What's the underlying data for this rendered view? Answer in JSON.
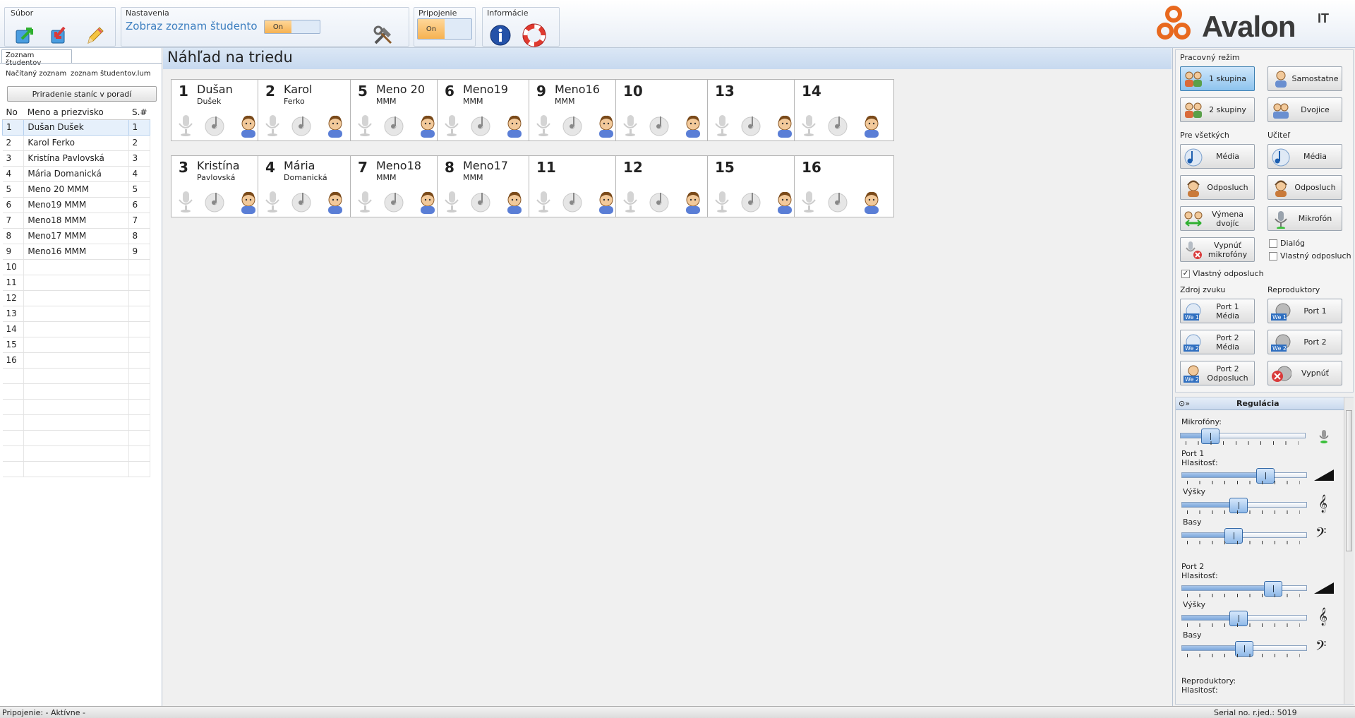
{
  "toolbar": {
    "groups": {
      "file": "Súbor",
      "settings": "Nastavenia",
      "connection": "Pripojenie",
      "info": "Informácie"
    },
    "show_list_label": "Zobraz zoznam študento",
    "show_list_toggle": "On",
    "connection_toggle": "On",
    "logo_text": "Avalon",
    "logo_suffix": "IT"
  },
  "left": {
    "tab": "Zoznam študentov",
    "loaded_label": "Načítaný zoznam",
    "loaded_file": "zoznam študentov.lum",
    "assign_button": "Priradenie staníc v poradí",
    "columns": [
      "No",
      "Meno a priezvisko",
      "S.#"
    ],
    "rows": [
      {
        "no": "1",
        "name": "Dušan  Dušek",
        "s": "1"
      },
      {
        "no": "2",
        "name": "Karol Ferko",
        "s": "2"
      },
      {
        "no": "3",
        "name": "Kristína Pavlovská",
        "s": "3"
      },
      {
        "no": "4",
        "name": "Mária Domanická",
        "s": "4"
      },
      {
        "no": "5",
        "name": "Meno 20 MMM",
        "s": "5"
      },
      {
        "no": "6",
        "name": "Meno19 MMM",
        "s": "6"
      },
      {
        "no": "7",
        "name": "Meno18 MMM",
        "s": "7"
      },
      {
        "no": "8",
        "name": "Meno17 MMM",
        "s": "8"
      },
      {
        "no": "9",
        "name": "Meno16 MMM",
        "s": "9"
      },
      {
        "no": "10",
        "name": "",
        "s": ""
      },
      {
        "no": "11",
        "name": "",
        "s": ""
      },
      {
        "no": "12",
        "name": "",
        "s": ""
      },
      {
        "no": "13",
        "name": "",
        "s": ""
      },
      {
        "no": "14",
        "name": "",
        "s": ""
      },
      {
        "no": "15",
        "name": "",
        "s": ""
      },
      {
        "no": "16",
        "name": "",
        "s": ""
      },
      {
        "no": "",
        "name": "",
        "s": ""
      },
      {
        "no": "",
        "name": "",
        "s": ""
      },
      {
        "no": "",
        "name": "",
        "s": ""
      },
      {
        "no": "",
        "name": "",
        "s": ""
      },
      {
        "no": "",
        "name": "",
        "s": ""
      },
      {
        "no": "",
        "name": "",
        "s": ""
      },
      {
        "no": "",
        "name": "",
        "s": ""
      }
    ]
  },
  "main": {
    "title": "Náhľad na triedu",
    "stations": [
      {
        "num": "1",
        "first": "Dušan",
        "last": "Dušek"
      },
      {
        "num": "2",
        "first": "Karol",
        "last": "Ferko"
      },
      {
        "num": "5",
        "first": "Meno 20",
        "last": "MMM"
      },
      {
        "num": "6",
        "first": "Meno19",
        "last": "MMM"
      },
      {
        "num": "9",
        "first": "Meno16",
        "last": "MMM"
      },
      {
        "num": "10",
        "first": "",
        "last": ""
      },
      {
        "num": "13",
        "first": "",
        "last": ""
      },
      {
        "num": "14",
        "first": "",
        "last": ""
      },
      {
        "num": "3",
        "first": "Kristína",
        "last": "Pavlovská"
      },
      {
        "num": "4",
        "first": "Mária",
        "last": "Domanická"
      },
      {
        "num": "7",
        "first": "Meno18",
        "last": "MMM"
      },
      {
        "num": "8",
        "first": "Meno17",
        "last": "MMM"
      },
      {
        "num": "11",
        "first": "",
        "last": ""
      },
      {
        "num": "12",
        "first": "",
        "last": ""
      },
      {
        "num": "15",
        "first": "",
        "last": ""
      },
      {
        "num": "16",
        "first": "",
        "last": ""
      }
    ]
  },
  "right": {
    "work_mode": "Pracovný režim",
    "mode_buttons": [
      "1 skupina",
      "Samostatne",
      "2 skupiny",
      "Dvojice"
    ],
    "for_all": "Pre všetkých",
    "teacher": "Učiteľ",
    "for_all_buttons": [
      "Média",
      "Odposluch",
      "Výmena dvojíc",
      "Vypnúť mikrofóny"
    ],
    "teacher_buttons": [
      "Média",
      "Odposluch",
      "Mikrofón"
    ],
    "dialog_cb": "Dialóg",
    "own_listen_cb": "Vlastný odposluch",
    "own_listen_cb2": "Vlastný odposluch",
    "sound_source": "Zdroj zvuku",
    "speakers": "Reproduktory",
    "source_buttons": [
      "Port 1 Média",
      "Port 2 Média",
      "Port 2 Odposluch"
    ],
    "speaker_buttons": [
      "Port 1",
      "Port 2",
      "Vypnúť"
    ],
    "we1": "We 1",
    "we2": "We 2",
    "regulation": "Regulácia",
    "microphones": "Mikrofóny:",
    "port1": "Port 1",
    "port2": "Port 2",
    "volume": "Hlasitosť:",
    "treble": "Výšky",
    "bass": "Basy",
    "speakers2": "Reproduktory:",
    "sliders": {
      "mic": 0.2,
      "p1_vol": 0.7,
      "p1_treble": 0.45,
      "p1_bass": 0.4,
      "p2_vol": 0.77,
      "p2_treble": 0.45,
      "p2_bass": 0.5
    }
  },
  "status": {
    "connection": "Pripojenie: - Aktívne -",
    "serial": "Serial no. r.jed.: 5019"
  },
  "colors": {
    "accent": "#e8691f",
    "toggle_on": "#f6b252",
    "header_blue": "#c7d9ef"
  }
}
